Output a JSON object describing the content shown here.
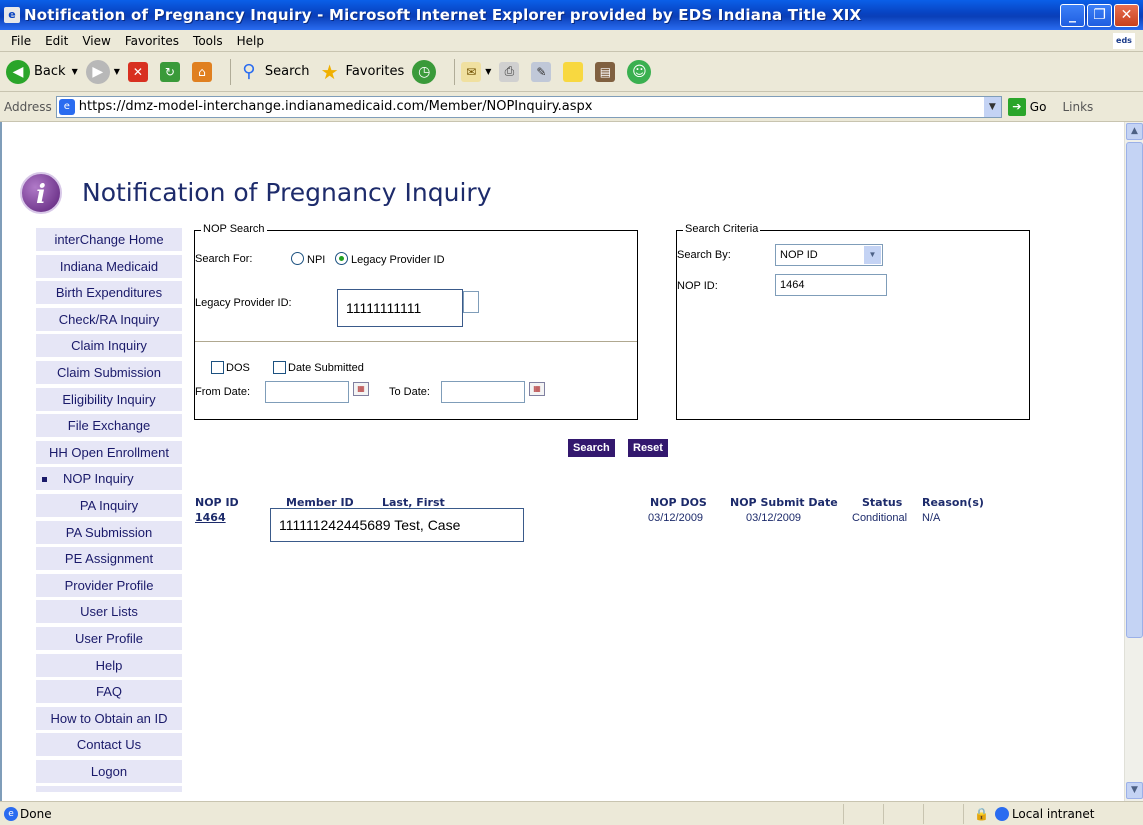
{
  "window": {
    "title": "Notification of Pregnancy Inquiry - Microsoft Internet Explorer provided by EDS Indiana Title XIX",
    "minimize": "_",
    "maximize": "❐",
    "close": "✕"
  },
  "menu": [
    "File",
    "Edit",
    "View",
    "Favorites",
    "Tools",
    "Help"
  ],
  "toolbar": {
    "back": "Back",
    "search": "Search",
    "favorites": "Favorites"
  },
  "address": {
    "label": "Address",
    "url": "https://dmz-model-interchange.indianamedicaid.com/Member/NOPInquiry.aspx",
    "go": "Go",
    "links": "Links"
  },
  "page": {
    "title": "Notification of Pregnancy Inquiry"
  },
  "nav": [
    "interChange Home",
    "Indiana Medicaid",
    "Birth Expenditures",
    "Check/RA Inquiry",
    "Claim Inquiry",
    "Claim Submission",
    "Eligibility Inquiry",
    "File Exchange",
    "HH Open Enrollment",
    "NOP Inquiry",
    "PA Inquiry",
    "PA Submission",
    "PE Assignment",
    "Provider Profile",
    "User Lists",
    "User Profile",
    "Help",
    "FAQ",
    "How to Obtain an ID",
    "Contact Us",
    "Logon"
  ],
  "nop_search": {
    "legend": "NOP Search",
    "search_for_label": "Search For:",
    "npi_label": "NPI",
    "legacy_label": "Legacy Provider ID",
    "legacy_id_label": "Legacy Provider ID:",
    "legacy_id_value": "11111111111",
    "dos_label": "DOS",
    "date_submitted_label": "Date Submitted",
    "from_date_label": "From Date:",
    "to_date_label": "To Date:"
  },
  "search_criteria": {
    "legend": "Search Criteria",
    "search_by_label": "Search By:",
    "search_by_value": "NOP ID",
    "nop_id_label": "NOP ID:",
    "nop_id_value": "1464"
  },
  "buttons": {
    "search": "Search",
    "reset": "Reset"
  },
  "results": {
    "headers": {
      "nop_id": "NOP ID",
      "member_id": "Member ID",
      "last_first": "Last, First",
      "nop_dos": "NOP DOS",
      "nop_submit_date": "NOP Submit Date",
      "status": "Status",
      "reasons": "Reason(s)"
    },
    "row": {
      "nop_id": "1464",
      "member_id_name": "111111242445689   Test, Case",
      "nop_dos": "03/12/2009",
      "nop_submit_date": "03/12/2009",
      "status": "Conditional",
      "reasons": "N/A"
    }
  },
  "status_bar": {
    "text": "Done",
    "zone": "Local intranet"
  }
}
